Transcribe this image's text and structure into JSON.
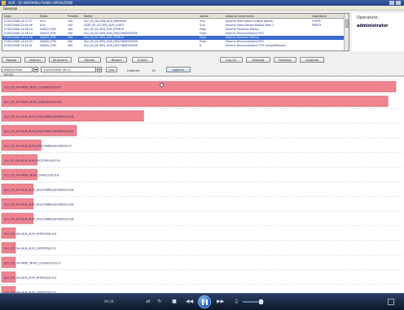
{
  "window": {
    "title": "ALM - SC-WORKING-PIANO-OPERAZIONI"
  },
  "menu": {
    "label": "Generali"
  },
  "alarm_table": {
    "columns": [
      "Data",
      "Stato",
      "Priorità",
      "Nome",
      "Valore",
      "Allarme Commento",
      "Operatore"
    ],
    "rows": [
      {
        "data": "07/05/2008 14:17:37",
        "stato": "ACK",
        "prio": "100",
        "nome": "SLV_05_DA-GEN_ALM_BREAKER",
        "valore": "True",
        "commento": "Allarme Interruttore di Base Aperto",
        "operatore": "CHEFE"
      },
      {
        "data": "07/05/2008 12:04:36",
        "stato": "ACK",
        "prio": "100",
        "nome": "CBEF_05_02-GEN_ALM_STATO",
        "valore": "True",
        "commento": "Allarme Stato Pompe Motore Main 2",
        "operatore": "PERFIX"
      },
      {
        "data": "07/05/2008 14:36:44",
        "stato": "UNACK_RTN",
        "prio": "500",
        "nome": "SLV_05_04-GEN_ALM_RITMUS",
        "valore": "False",
        "commento": "Allarme Presenza Ritmus",
        "operatore": ""
      },
      {
        "data": "07/05/2008 14:36:44",
        "stato": "UNACK_RTN",
        "prio": "500",
        "nome": "SLV_05_04-GEN_ALM_DISCONNESSIONE",
        "valore": "False",
        "commento": "Allarme Disconnessione RTU",
        "operatore": ""
      },
      {
        "data": "07/05/2008 14:41:46",
        "stato": "UNACK_RTN",
        "prio": "500",
        "nome": "SLV_05_04-GEN_ALM_RITMUS",
        "valore": "False",
        "commento": "Allarme Presenza Ritmus",
        "operatore": ""
      },
      {
        "data": "07/05/2008 14:44:33",
        "stato": "UNACK_RTN",
        "prio": "500",
        "nome": "SLV_05_04-GEN_ALM_DISCONNESSIONE",
        "valore": "False",
        "commento": "Allarme Disconnessione RTU",
        "operatore": ""
      },
      {
        "data": "07/05/2008 14:48:41",
        "stato": "UNACK_RTN",
        "prio": "500",
        "nome": "SLV_05_04-GEN_ALM_DISCONNESSIONE",
        "valore": "0",
        "commento": "Allarme Disconnessione CPU Campo/Remoto",
        "operatore": ""
      }
    ],
    "selected_row": 4
  },
  "right_panel": {
    "label": "Operatore:",
    "user": "administrator"
  },
  "buttons": {
    "mappa": "Mappa",
    "allarmi": "Allarmi",
    "st_allarmi": "St.allarmi",
    "parallo": "Parallo",
    "report": "Report",
    "eventi": "Eventi",
    "log_on": "Log On",
    "stampa": "Stampa",
    "sistema": "Sistema",
    "legenda": "Legenda"
  },
  "filter": {
    "from": "06/05/2008 00:00",
    "to": "14/05/2008 18:11",
    "ora_label": "Ora",
    "colonne_label": "Colonne",
    "colonne_value": "15",
    "apply_label": "Applica"
  },
  "chart_data": {
    "type": "bar",
    "orientation": "horizontal",
    "categories": [
      "SLV_05_04-TANK_MON_LLEVREGISTI16",
      "SLV_05_04-TANK_MON_LVERIREGISTI16",
      "SLV_05_04-GEN_ALM_DISCONNESSIONEFISCI16",
      "SLV_05_04-GEN_ALM_DISCONNESSIONEFISCI16",
      "SLV_05_04-GEN_ALM_DISCONNESSIONEFISCI7",
      "SLV_05_04-GEN_ALM_RICETREGISTI16",
      "SLV_05_04-TANK_MON_LVFALLTISCI16",
      "SLV_05_04-GEN_ALM_DISCONNESSIONEFISCI16",
      "SLV_05_04-GEN_ALM_DISCONNESSIONEFISCI16",
      "SLV_05_04-GEN_ALM_DISCONNESSIONEFISCI16",
      "SLV_05_04-GEN_ALM_INTRUSISCI16",
      "SLV_05_04-GEN_ALM_SUPPLYISCI13",
      "SLV_05_04-TANK_MON_LLEVREGISTI13",
      "SLV_05_04-GEN_ALM_INTRUSISCI13",
      "SLV_05_04-GEN_ALM_SUPPLYISCI13"
    ],
    "values": [
      100,
      98,
      36,
      19,
      10,
      9,
      9,
      8,
      8,
      8,
      3.5,
      3.5,
      3.5,
      3.5,
      3.5
    ],
    "xlim": [
      0,
      100
    ],
    "grid": true,
    "bar_color": "#f08490"
  },
  "player": {
    "time": "00:28"
  }
}
